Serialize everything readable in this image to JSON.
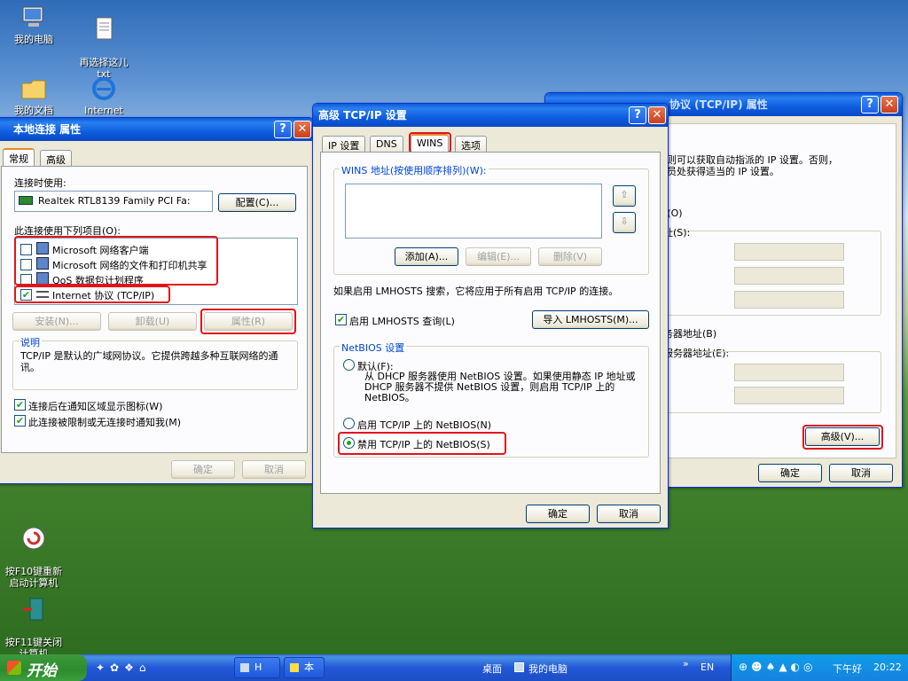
{
  "desktop": {
    "icons": [
      {
        "label": "我的电脑"
      },
      {
        "label": "再选择这儿\ntxt"
      },
      {
        "label": "我的文档"
      },
      {
        "label": "Internet"
      },
      {
        "label": "按F10键重新\n启动计算机"
      },
      {
        "label": "按F11键关闭\n计算机"
      }
    ]
  },
  "win_local": {
    "title": "本地连接 属性",
    "tabs": [
      "常规",
      "高级"
    ],
    "connect_using_label": "连接时使用:",
    "adapter_name": "Realtek RTL8139 Family PCI Fa:",
    "configure_btn": "配置(C)...",
    "items_label": "此连接使用下列项目(O):",
    "items": [
      {
        "label": "Microsoft 网络客户端",
        "checked": false
      },
      {
        "label": "Microsoft 网络的文件和打印机共享",
        "checked": false
      },
      {
        "label": "QoS 数据包计划程序",
        "checked": false
      },
      {
        "label": "Internet 协议 (TCP/IP)",
        "checked": true
      }
    ],
    "install_btn": "安装(N)...",
    "uninstall_btn": "卸载(U)",
    "properties_btn": "属性(R)",
    "desc_title": "说明",
    "desc_text": "TCP/IP 是默认的广域网协议。它提供跨越多种互联网络的通讯。",
    "opt_show_icon": "连接后在通知区域显示图标(W)",
    "opt_notify": "此连接被限制或无连接时通知我(M)",
    "ok": "确定",
    "cancel": "取消"
  },
  "win_adv": {
    "title": "高级 TCP/IP 设置",
    "tabs": [
      "IP 设置",
      "DNS",
      "WINS",
      "选项"
    ],
    "wins_label": "WINS 地址(按使用顺序排列)(W):",
    "add_btn": "添加(A)...",
    "edit_btn": "编辑(E)...",
    "remove_btn": "删除(V)",
    "lmhosts_info": "如果启用 LMHOSTS 搜索，它将应用于所有启用 TCP/IP 的连接。",
    "enable_lmhosts": "启用 LMHOSTS 查询(L)",
    "import_btn": "导入 LMHOSTS(M)...",
    "netbios_title": "NetBIOS 设置",
    "opt_default": "默认(F):",
    "default_desc": "从 DHCP 服务器使用 NetBIOS 设置。如果使用静态 IP 地址或 DHCP 服务器不提供 NetBIOS 设置，则启用 TCP/IP 上的 NetBIOS。",
    "opt_enable": "启用 TCP/IP 上的 NetBIOS(N)",
    "opt_disable": "禁用 TCP/IP 上的 NetBIOS(S)",
    "ok": "确定",
    "cancel": "取消"
  },
  "win_tcpip": {
    "title": "协议 (TCP/IP) 属性",
    "text1": "则可以获取自动指派的 IP 设置。否则，",
    "text2": "员处获得适当的 IP 设置。",
    "frag1": "t(O)",
    "frag2": "址(S):",
    "frag3": "务器地址(B)",
    "frag4": "服务器地址(E):",
    "advanced_btn": "高级(V)...",
    "ok": "确定",
    "cancel": "取消"
  },
  "taskbar": {
    "start": "开始",
    "task1": "H",
    "task2": "本",
    "desktop_label": "桌面",
    "mycomputer_label": "我的电脑",
    "lang": "EN",
    "greeting": "下午好",
    "time": "20:22"
  }
}
